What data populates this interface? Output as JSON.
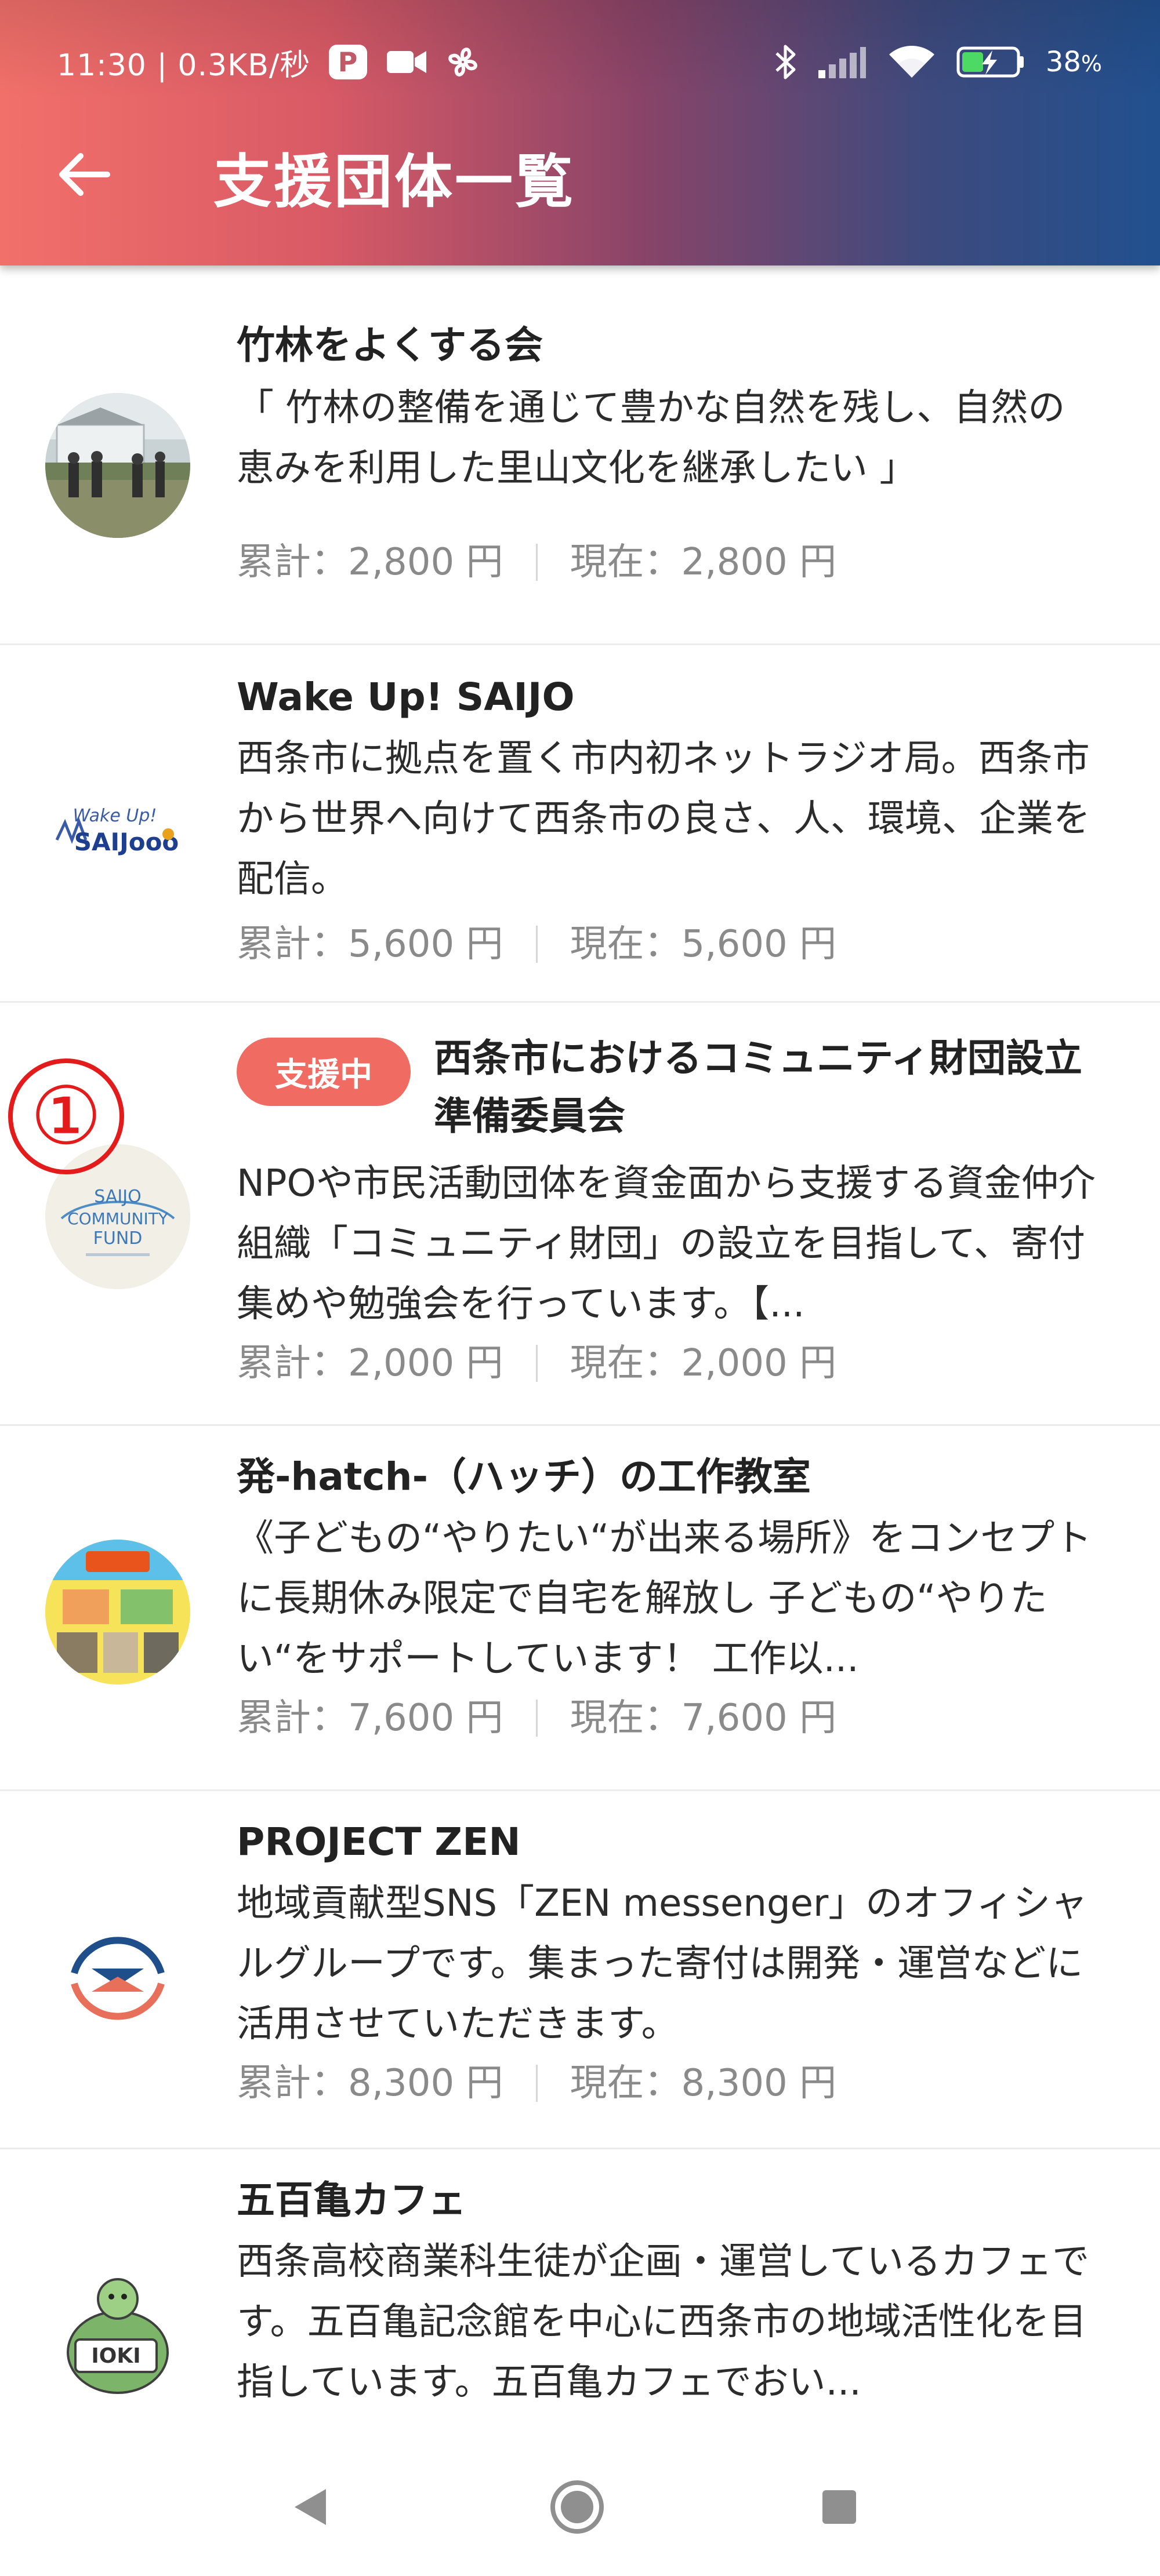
{
  "status_bar": {
    "time_info": "11:30 | 0.3KB/秒",
    "battery_percent": "38"
  },
  "app_bar": {
    "title": "支援団体一覧"
  },
  "items": [
    {
      "title": "竹林をよくする会",
      "desc": "「 竹林の整備を通じて豊かな自然を残し、自然の恵みを利用した里山文化を継承したい 」",
      "total": "累計：2,800 円",
      "current": "現在：2,800 円"
    },
    {
      "title": "Wake Up! SAIJO",
      "desc": "西条市に拠点を置く市内初ネットラジオ局。西条市から世界へ向けて西条市の良さ、人、環境、企業を配信。",
      "total": "累計：5,600 円",
      "current": "現在：5,600 円",
      "logo_text": "SAIJooo"
    },
    {
      "badge": "支援中",
      "title": "西条市におけるコミュニティ財団設立準備委員会",
      "desc": "NPOや市民活動団体を資金面から支援する資金仲介組織「コミュニティ財団」の設立を目指して、寄付集めや勉強会を行っています。【...",
      "total": "累計：2,000 円",
      "current": "現在：2,000 円",
      "logo_text_1": "SAIJO",
      "logo_text_2": "COMMUNITY",
      "logo_text_3": "FUND"
    },
    {
      "title": "発-hatch-（ハッチ）の工作教室",
      "desc": "《子どもの“やりたい“が出来る場所》をコンセプトに長期休み限定で自宅を解放し 子どもの“やりたい“をサポートしています！ 工作以...",
      "total": "累計：7,600 円",
      "current": "現在：7,600 円"
    },
    {
      "title": "PROJECT ZEN",
      "desc": "地域貢献型SNS「ZEN messenger」のオフィシャルグループです。集まった寄付は開発・運営などに活用させていただきます。",
      "total": "累計：8,300 円",
      "current": "現在：8,300 円"
    },
    {
      "title": "五百亀カフェ",
      "desc": "西条高校商業科生徒が企画・運営しているカフェです。五百亀記念館を中心に西条市の地域活性化を目指しています。五百亀カフェでおい...",
      "logo_text": "IOKI"
    }
  ],
  "annotation": {
    "marker": "①"
  },
  "colors": {
    "header_gradient_start": "#f2706a",
    "header_gradient_end": "#21508f",
    "badge": "#f06b62",
    "marker": "#e31b1b"
  }
}
